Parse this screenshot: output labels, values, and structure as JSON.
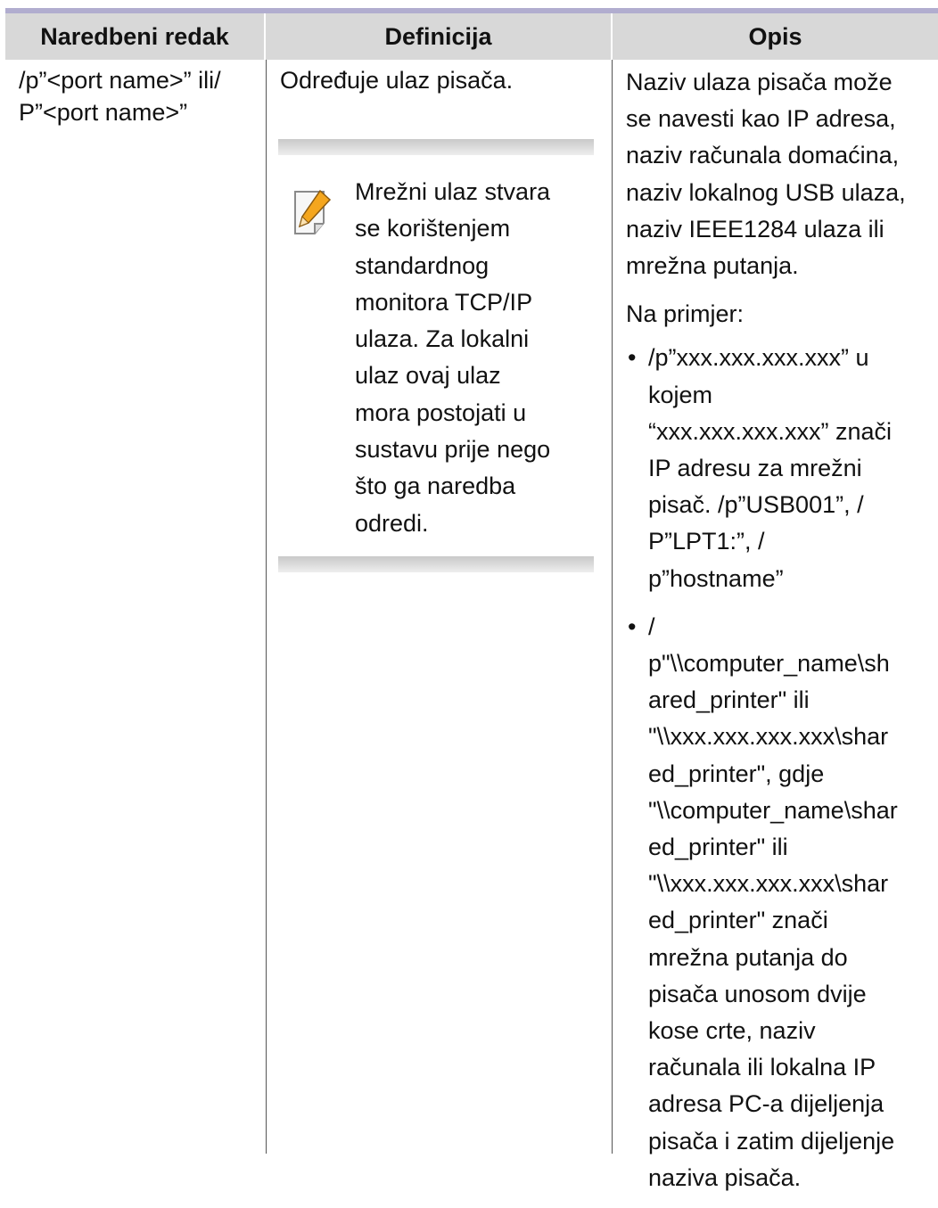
{
  "table": {
    "headers": [
      "Naredbeni redak",
      "Definicija",
      "Opis"
    ],
    "row": {
      "command": [
        "/p”<port name>” ili/",
        "P”<port name>”"
      ],
      "definition": "Određuje ulaz pisača.",
      "note": [
        "Mrežni ulaz stvara",
        "se korištenjem",
        "standardnog",
        "monitora TCP/IP",
        "ulaza. Za lokalni",
        "ulaz ovaj ulaz",
        "mora postojati u",
        "sustavu prije nego",
        "što ga naredba",
        "odredi."
      ],
      "description_intro": [
        "Naziv ulaza pisača može",
        "se navesti kao IP adresa,",
        "naziv računala domaćina,",
        "naziv lokalnog USB ulaza,",
        "naziv IEEE1284 ulaza ili",
        "mrežna putanja."
      ],
      "example_label": "Na primjer:",
      "bullet_symbol": "•",
      "bullets": [
        [
          "/p”xxx.xxx.xxx.xxx” u",
          "kojem",
          "“xxx.xxx.xxx.xxx” znači",
          "IP adresu za mrežni",
          "pisač. /p”USB001”, /",
          "P”LPT1:”, /",
          "p”hostname”"
        ],
        [
          "/",
          "p\"\\\\computer_name\\sh",
          "ared_printer\" ili",
          "\"\\\\xxx.xxx.xxx.xxx\\shar",
          "ed_printer\", gdje",
          "\"\\\\computer_name\\shar",
          "ed_printer\" ili",
          "\"\\\\xxx.xxx.xxx.xxx\\shar",
          "ed_printer\" znači",
          "mrežna putanja do",
          "pisača unosom dvije",
          "kose crte, naziv",
          "računala ili lokalna IP",
          "adresa PC-a dijeljenja",
          "pisača i zatim dijeljenje",
          "naziva pisača."
        ]
      ]
    }
  },
  "note_icon": "note-pencil-icon",
  "colors": {
    "header_bg": "#d8d8d8",
    "top_rule": "#b1adcf",
    "note_bar": "#c9c9c9",
    "pencil": "#f4a61e"
  }
}
